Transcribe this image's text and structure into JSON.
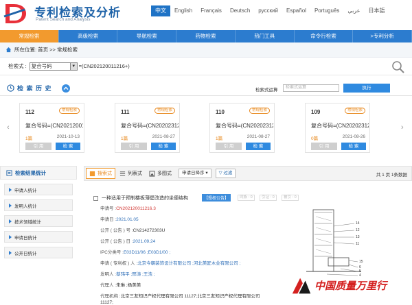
{
  "header": {
    "logo_title": "专利检索及分析",
    "logo_sub": "Patent Search and Analysis",
    "languages": [
      "中文",
      "English",
      "Français",
      "Deutsch",
      "русский",
      "Español",
      "Português",
      "عربي",
      "日本語"
    ],
    "active_language": "中文"
  },
  "nav": {
    "items": [
      "常规检索",
      "高级检索",
      "导航检索",
      "药物检索",
      "热门工具",
      "命令行检索",
      ">专利分析"
    ],
    "active": "常规检索"
  },
  "breadcrumb": {
    "prefix": "所在位置:",
    "path": "首页 >> 常规检索"
  },
  "search": {
    "label": "检索式 :",
    "field": "复合号码",
    "expression": "=(CN202120011216+)"
  },
  "history": {
    "title": "检 索 历 史",
    "ops_label": "检索式运算",
    "ops_placeholder": "检索式运算",
    "execute_label": "执行",
    "cards": [
      {
        "no": "112",
        "tag": "常规检索",
        "expr": "复合号码=(CN20212001…",
        "hits": "1篇",
        "date": "2021-10-13",
        "cite": "引 用",
        "go": "检 索"
      },
      {
        "no": "111",
        "tag": "常规检索",
        "expr": "复合号码=(CN20202312…",
        "hits": "1篇",
        "date": "2021-08-27",
        "cite": "引 用",
        "go": "检 索"
      },
      {
        "no": "110",
        "tag": "常规检索",
        "expr": "复合号码=(CN20202312…",
        "hits": "1篇",
        "date": "2021-08-27",
        "cite": "引 用",
        "go": "检 索"
      },
      {
        "no": "109",
        "tag": "常规检索",
        "expr": "复合号码=(CN20202312…",
        "hits": "0篇",
        "date": "2021-08-26",
        "cite": "引 用",
        "go": "检 索"
      }
    ]
  },
  "stats": {
    "title": "检索结果统计",
    "items": [
      "申请人统计",
      "发明人统计",
      "技术领域统计",
      "申请日统计",
      "公开日统计"
    ]
  },
  "toolbar": {
    "view_overview": "搜索式",
    "view_list": "列表式",
    "view_multi": "多图式",
    "sort": "申请日降序",
    "filter": "过滤",
    "page_info": "共 1 页 1条数据"
  },
  "result": {
    "title": "一种适用于预制楼板薄壁改造的坐便结构",
    "badge": "【授权公告】",
    "badge_small": [
      "同族 : 0",
      "引证 : 0",
      "被引 : 0"
    ],
    "rows": [
      {
        "k": "申请号 :",
        "v": "CN202120011216.3",
        "style": "red"
      },
      {
        "k": "申请日 :",
        "v": "2021.01.05",
        "style": "blue"
      },
      {
        "k": "公开 ( 公告 ) 号 :",
        "v": "CN214272303U",
        "style": ""
      },
      {
        "k": "公开 ( 公告 ) 日 :",
        "v": "2021.09.24",
        "style": "blue"
      },
      {
        "k": "IPC分类号 :",
        "v": "E03D11/06 ;E03D1/00 ;",
        "style": "blue"
      },
      {
        "k": "申请 ( 专利权 ) 人 :",
        "v": "北京今朝装饰设计有限公司 ;河北美匠木业有限公司 ;",
        "style": "blue"
      },
      {
        "k": "发明人 :",
        "v": "蔡玮平 ;邢涛 ;王浩 ;",
        "style": "blue"
      },
      {
        "k": "代理人 :",
        "v": "朱琳 ;杨美美",
        "style": ""
      },
      {
        "k": "代理机构 :",
        "v": "北京三友知识产权代理有限公司 11127;北京三友知识产权代理有限公司",
        "style": ""
      },
      {
        "k": "",
        "v": "11127;",
        "style": ""
      }
    ],
    "figure_labels": [
      "14",
      "12",
      "13",
      "11",
      "15",
      "6",
      "5",
      "4"
    ]
  },
  "watermark": {
    "text": "中国质量万里行"
  }
}
